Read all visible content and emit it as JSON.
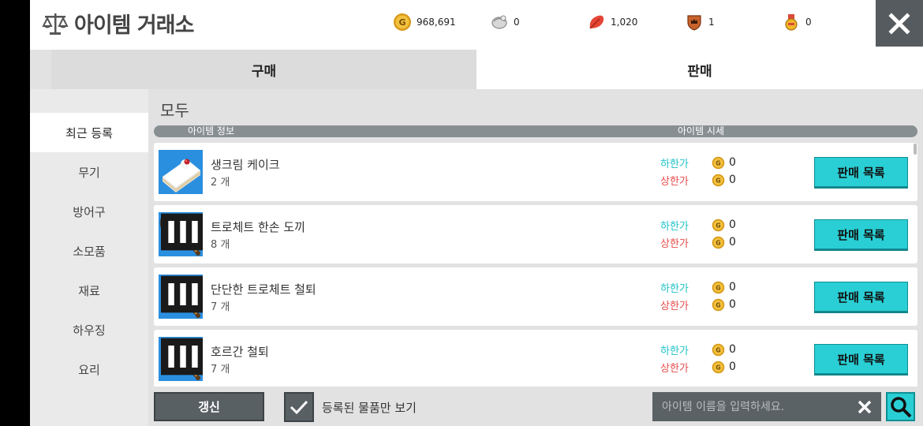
{
  "header": {
    "title": "아이템 거래소",
    "currencies": [
      {
        "icon": "gold-coin-icon",
        "value": "968,691"
      },
      {
        "icon": "silver-shell-icon",
        "value": "0"
      },
      {
        "icon": "red-leaf-icon",
        "value": "1,020"
      },
      {
        "icon": "crown-shield-icon",
        "value": "1"
      },
      {
        "icon": "medal-icon",
        "value": "0"
      }
    ]
  },
  "tabs": {
    "buy": "구매",
    "sell": "판매"
  },
  "sidebar": {
    "items": [
      "최근 등록",
      "무기",
      "방어구",
      "소모품",
      "재료",
      "하우징",
      "요리"
    ]
  },
  "main": {
    "section_title": "모두",
    "col_item_info": "아이템 정보",
    "col_item_price": "아이템 시세",
    "low_label": "하한가",
    "high_label": "상한가",
    "list_button": "판매 목록",
    "rows": [
      {
        "name": "생크림 케이크",
        "count": "2 개",
        "low": "0",
        "high": "0",
        "icon": "cake-icon"
      },
      {
        "name": "트로체트 한손 도끼",
        "count": "8 개",
        "low": "0",
        "high": "0",
        "icon": "axe-icon"
      },
      {
        "name": "단단한 트로체트 철퇴",
        "count": "7 개",
        "low": "0",
        "high": "0",
        "icon": "mace-icon"
      },
      {
        "name": "호르간 철퇴",
        "count": "7 개",
        "low": "0",
        "high": "0",
        "icon": "mace-icon"
      }
    ]
  },
  "bottom": {
    "refresh": "갱신",
    "checkbox_label": "등록된 물품만 보기",
    "checkbox_checked": true,
    "search_placeholder": "아이템 이름을 입력하세요."
  },
  "colors": {
    "accent": "#29cfd4",
    "low_price": "#1ec2c8",
    "high_price": "#e84a4a",
    "dark_button": "#596064"
  }
}
